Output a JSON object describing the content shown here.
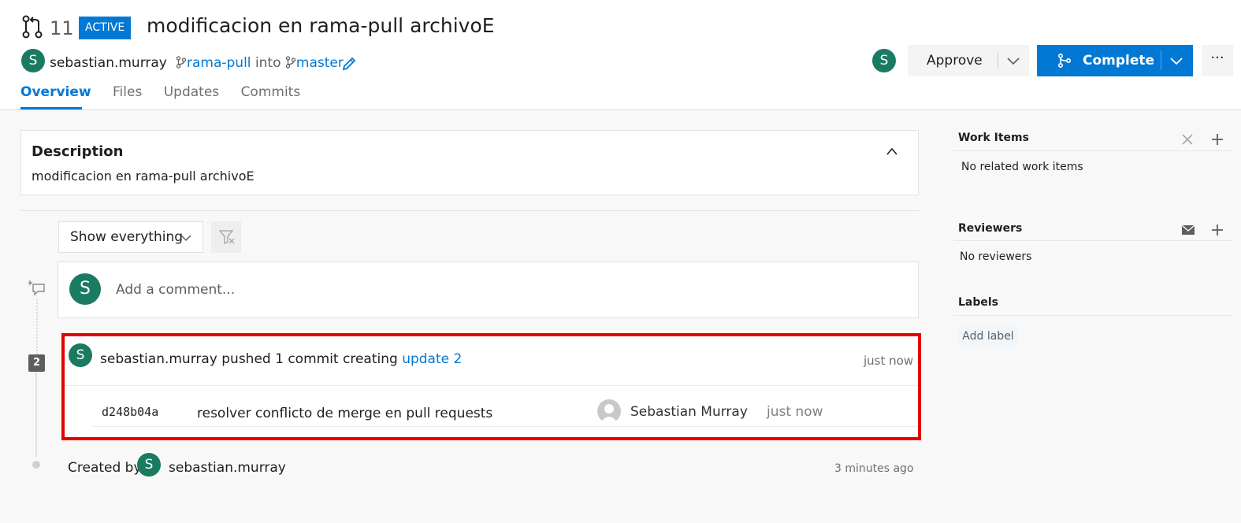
{
  "pr": {
    "number": "11",
    "status": "ACTIVE",
    "title": "modificacion en rama-pull archivoE",
    "author_initial": "S",
    "author": "sebastian.murray",
    "source_branch": "rama-pull",
    "into_text": "into",
    "target_branch": "master"
  },
  "tabs": [
    "Overview",
    "Files",
    "Updates",
    "Commits"
  ],
  "actions": {
    "reviewer_initial": "S",
    "approve_label": "Approve",
    "complete_label": "Complete",
    "more_label": "···"
  },
  "description": {
    "title": "Description",
    "text": "modificacion en rama-pull archivoE"
  },
  "filter": {
    "selected": "Show everything"
  },
  "comment": {
    "avatar_initial": "S",
    "placeholder": "Add a comment..."
  },
  "timeline": {
    "update_badge": "2",
    "push": {
      "avatar_initial": "S",
      "text": "sebastian.murray pushed 1 commit creating ",
      "link": "update 2",
      "time": "just now",
      "commit": {
        "hash": "d248b04a",
        "message": "resolver conflicto de merge en pull requests",
        "author": "Sebastian Murray",
        "time": "just now"
      }
    },
    "created": {
      "label": "Created by",
      "avatar_initial": "S",
      "author": "sebastian.murray",
      "time": "3 minutes ago"
    }
  },
  "sidebar": {
    "work_items": {
      "title": "Work Items",
      "empty": "No related work items"
    },
    "reviewers": {
      "title": "Reviewers",
      "empty": "No reviewers"
    },
    "labels": {
      "title": "Labels",
      "add": "Add label"
    }
  },
  "colors": {
    "accent": "#0078d4",
    "avatar": "#1b7a62",
    "highlight_border": "#e60000"
  }
}
